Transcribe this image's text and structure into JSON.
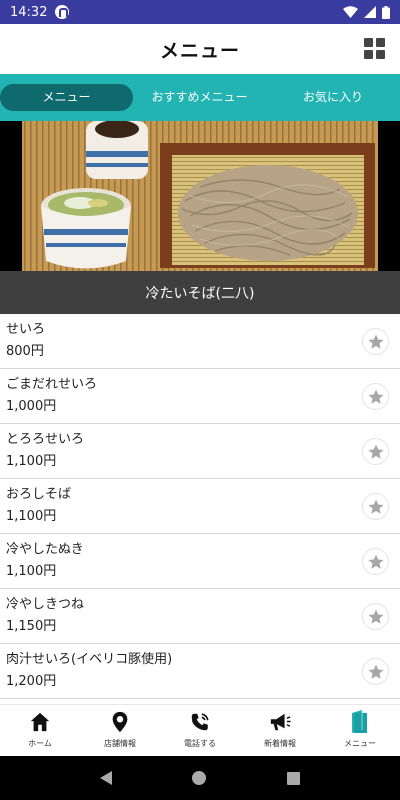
{
  "status_bar": {
    "time": "14:32"
  },
  "header": {
    "title": "メニュー"
  },
  "tabs": [
    {
      "label": "メニュー",
      "active": true
    },
    {
      "label": "おすすめメニュー",
      "active": false
    },
    {
      "label": "お気に入り",
      "active": false
    }
  ],
  "category": {
    "title": "冷たいそば(二八)"
  },
  "menu_items": [
    {
      "name": "せいろ",
      "price": "800円"
    },
    {
      "name": "ごまだれせいろ",
      "price": "1,000円"
    },
    {
      "name": "とろろせいろ",
      "price": "1,100円"
    },
    {
      "name": "おろしそば",
      "price": "1,100円"
    },
    {
      "name": "冷やしたぬき",
      "price": "1,100円"
    },
    {
      "name": "冷やしきつね",
      "price": "1,150円"
    },
    {
      "name": "肉汁せいろ(イベリコ豚使用)",
      "price": "1,200円"
    }
  ],
  "bottom_nav": [
    {
      "label": "ホーム",
      "icon": "home-icon"
    },
    {
      "label": "店舗情報",
      "icon": "map-pin-icon"
    },
    {
      "label": "電話する",
      "icon": "phone-icon"
    },
    {
      "label": "新着情報",
      "icon": "megaphone-icon"
    },
    {
      "label": "メニュー",
      "icon": "menu-book-icon",
      "active": true
    }
  ],
  "colors": {
    "status_bar": "#3a3b9e",
    "tab_bar": "#22b3b3",
    "tab_active": "#0f6a6e",
    "category_bar": "#3f3f3f",
    "nav_active": "#22b3b3"
  }
}
